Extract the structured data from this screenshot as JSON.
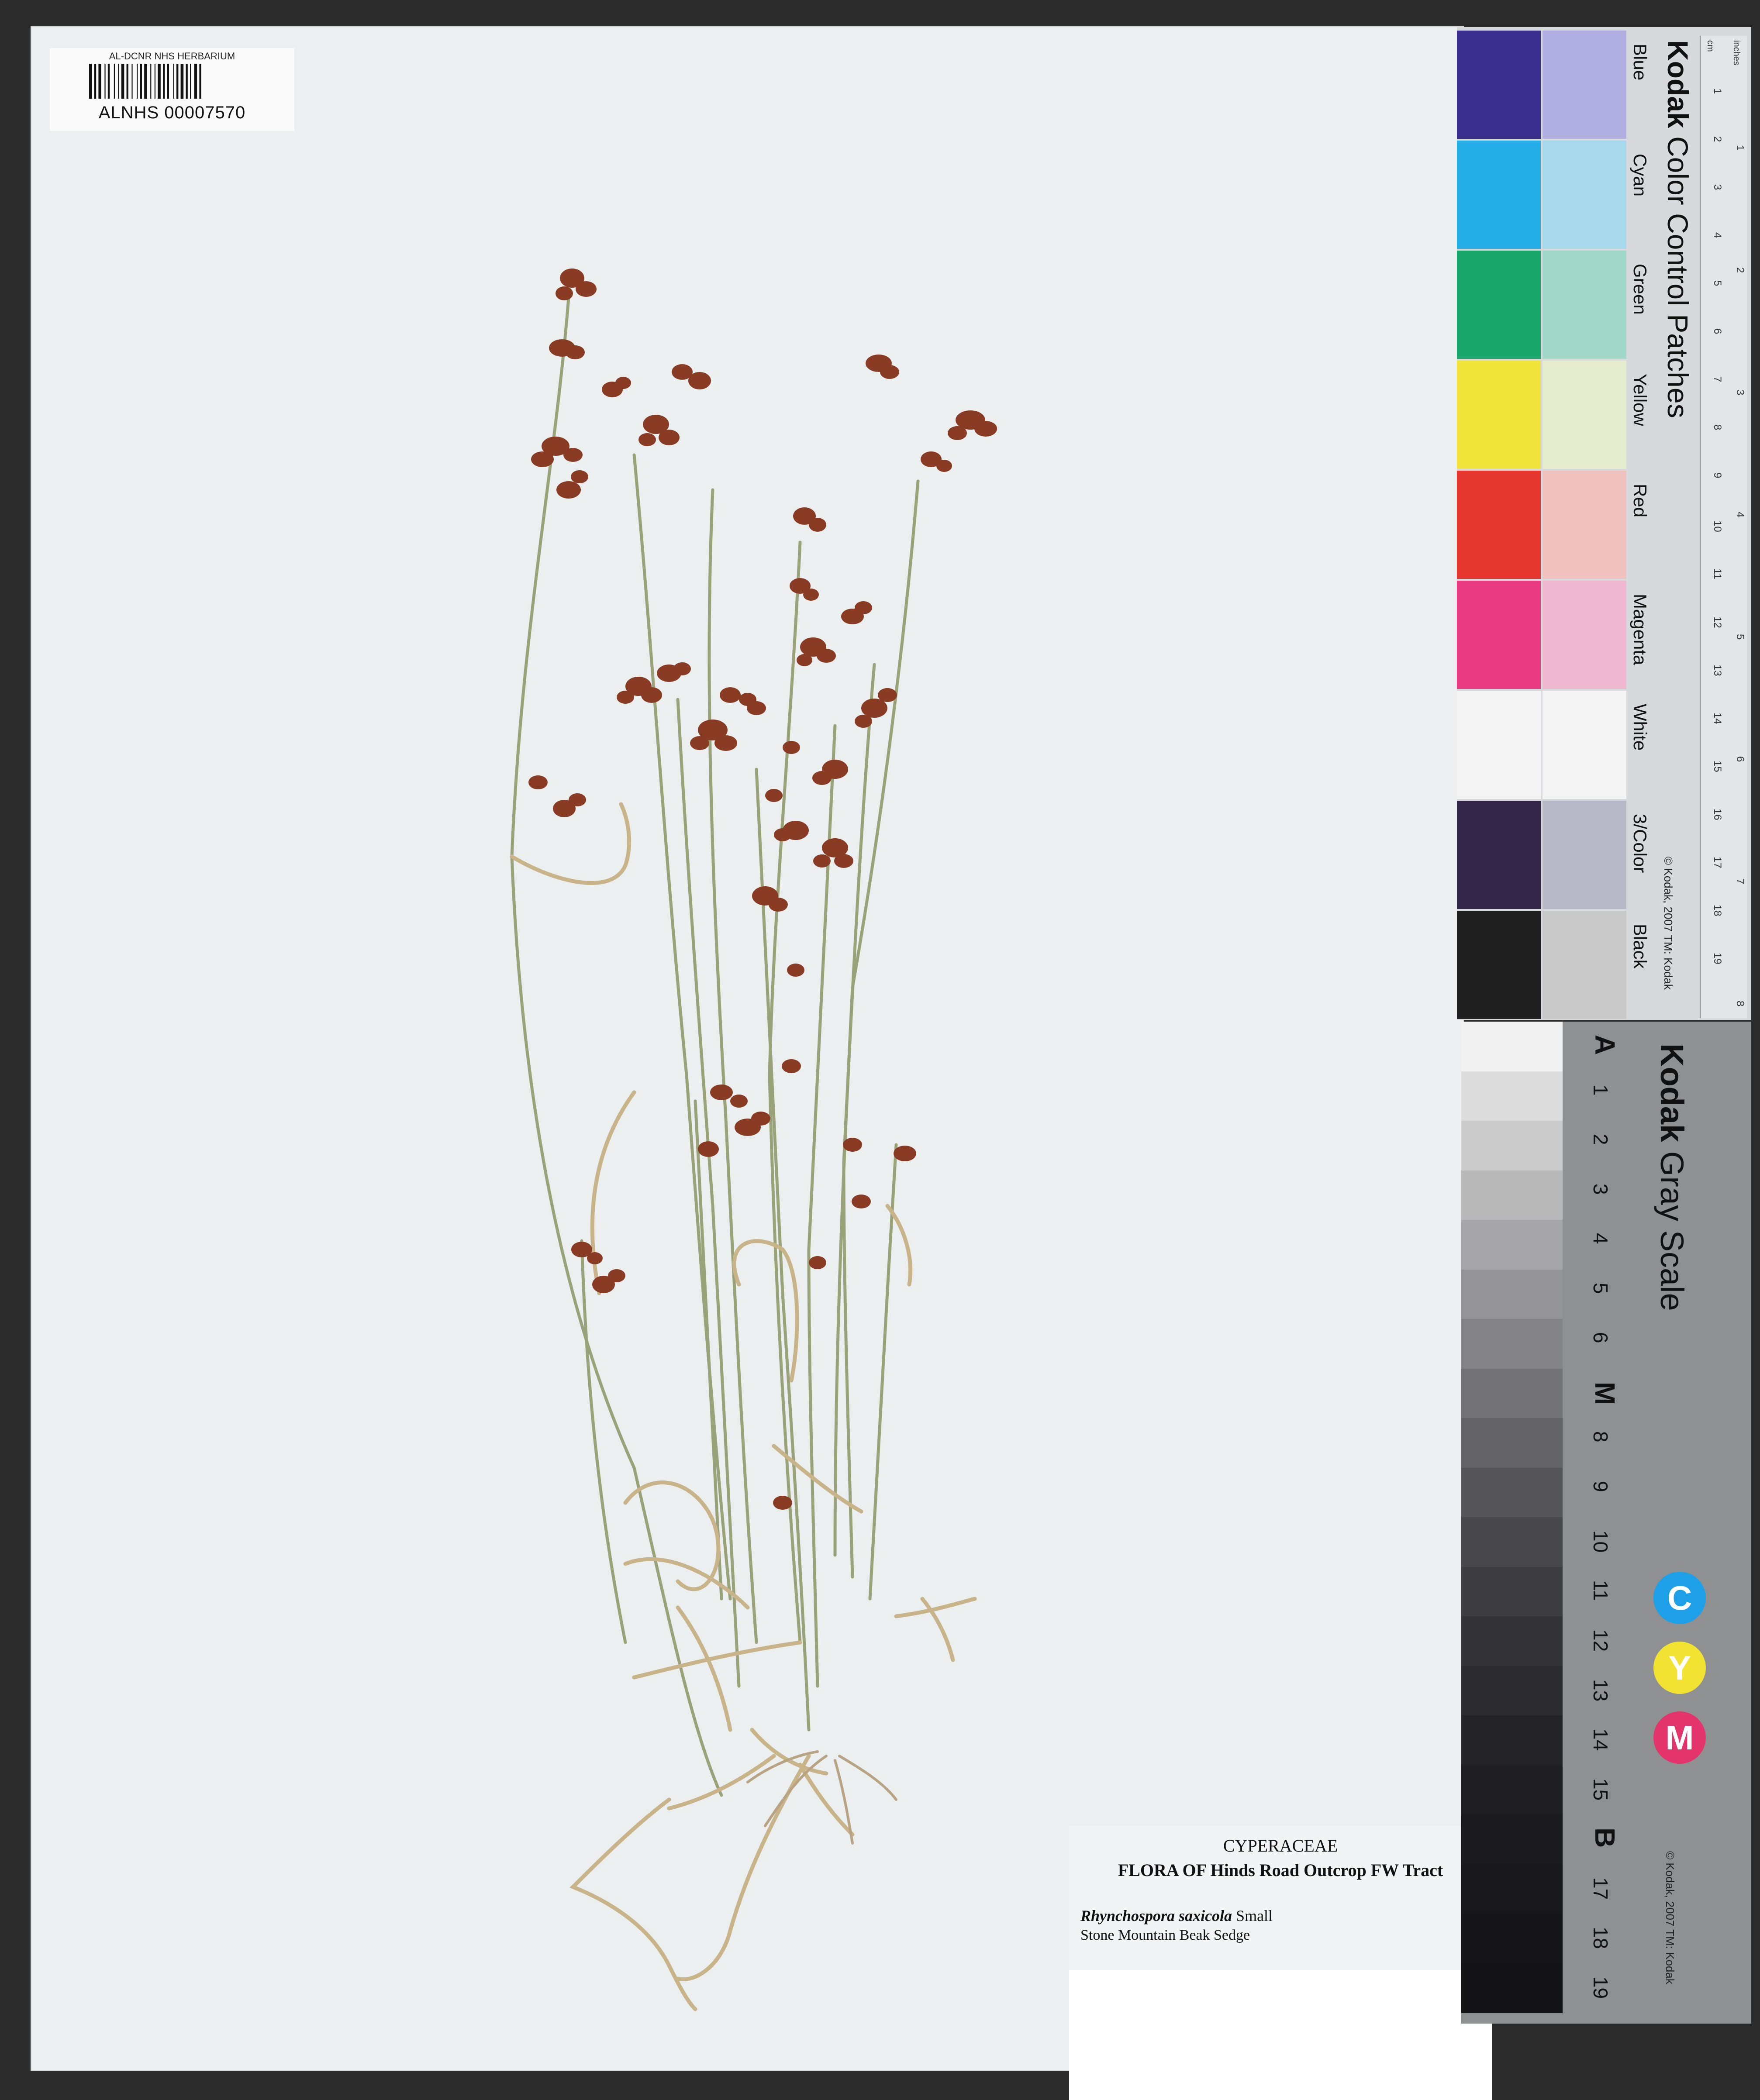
{
  "barcode_label": {
    "header": "AL-DCNR NHS HERBARIUM",
    "number": "ALNHS 00007570"
  },
  "determination_label": {
    "family": "CYPERACEAE",
    "flora": "FLORA OF Hinds Road Outcrop FW Tract",
    "species_name": "Rhynchospora saxicola",
    "species_author": "Small",
    "common_name": "Stone Mountain Beak Sedge"
  },
  "color_chart": {
    "title_brand": "Kodak",
    "title_rest": "Color Control Patches",
    "patches": [
      {
        "name": "Blue",
        "dark": "#3a2f8c",
        "light": "#b0aee0"
      },
      {
        "name": "Cyan",
        "dark": "#26aee9",
        "light": "#a8d8ec"
      },
      {
        "name": "Green",
        "dark": "#18a66a",
        "light": "#a2d8c8"
      },
      {
        "name": "Yellow",
        "dark": "#f0e43a",
        "light": "#e6edcf"
      },
      {
        "name": "Red",
        "dark": "#e5362f",
        "light": "#f0c2bd"
      },
      {
        "name": "Magenta",
        "dark": "#e93a82",
        "light": "#f0b8d0"
      },
      {
        "name": "White",
        "dark": "#f4f4f4",
        "light": "#f4f4f4"
      },
      {
        "name": "3/Color",
        "dark": "#33244a",
        "light": "#b9b8c8"
      },
      {
        "name": "Black",
        "dark": "#1e1e1e",
        "light": "#c9c9c9"
      }
    ],
    "copyright": "© Kodak, 2007 TM: Kodak",
    "ruler_units": [
      "cm",
      "inches"
    ],
    "ruler_cm": [
      "1",
      "2",
      "3",
      "4",
      "5",
      "6",
      "7",
      "8",
      "9",
      "10",
      "11",
      "12",
      "13",
      "14",
      "15",
      "16",
      "17",
      "18",
      "19"
    ],
    "ruler_in": [
      "1",
      "2",
      "3",
      "4",
      "5",
      "6",
      "7",
      "8"
    ]
  },
  "gray_scale": {
    "title_brand": "Kodak",
    "title_rest": "Gray Scale",
    "ticks": [
      "A",
      "1",
      "2",
      "3",
      "4",
      "5",
      "6",
      "M",
      "8",
      "9",
      "10",
      "11",
      "12",
      "13",
      "14",
      "15",
      "B",
      "17",
      "18",
      "19"
    ],
    "patch_colors": [
      "#f1f1f1",
      "#dcdcdc",
      "#cbcbcc",
      "#b8b8b9",
      "#a6a6a8",
      "#949496",
      "#838385",
      "#727274",
      "#636365",
      "#555557",
      "#48484a",
      "#3d3d3f",
      "#333335",
      "#2b2b2d",
      "#242426",
      "#1f1f21",
      "#1b1b1d",
      "#18181a",
      "#161618",
      "#141416"
    ],
    "cmy": [
      {
        "letter": "C",
        "color": "#1ea0e8"
      },
      {
        "letter": "Y",
        "color": "#f2e232"
      },
      {
        "letter": "M",
        "color": "#e4346c"
      }
    ],
    "copyright": "© Kodak, 2007 TM: Kodak"
  }
}
